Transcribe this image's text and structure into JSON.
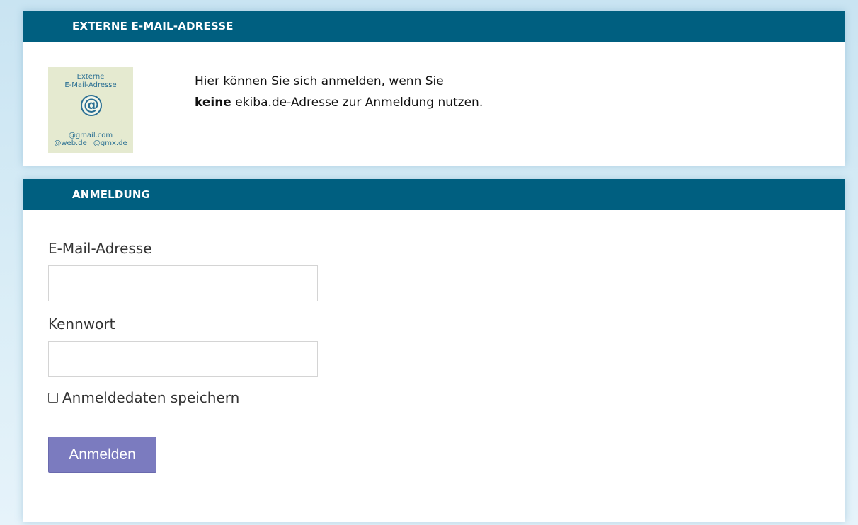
{
  "external_panel": {
    "header": "EXTERNE E-MAIL-ADRESSE",
    "logo": {
      "line1": "Externe",
      "line2": "E-Mail-Adresse",
      "symbol": "@",
      "line3": "@gmail.com",
      "line4": "@web.de @gmx.de"
    },
    "info_line1": "Hier können Sie sich anmelden, wenn Sie",
    "info_line2_bold": "keine",
    "info_line2_rest": " ekiba.de-Adresse zur Anmeldung nutzen."
  },
  "login_panel": {
    "header": "ANMELDUNG",
    "email_label": "E-Mail-Adresse",
    "email_value": "",
    "password_label": "Kennwort",
    "password_value": "",
    "remember_label": "Anmeldedaten speichern",
    "remember_checked": false,
    "submit_label": "Anmelden"
  },
  "colors": {
    "header_bg": "#005f80",
    "button_bg": "#7b7bbf",
    "page_bg": "#c9e4f2"
  }
}
